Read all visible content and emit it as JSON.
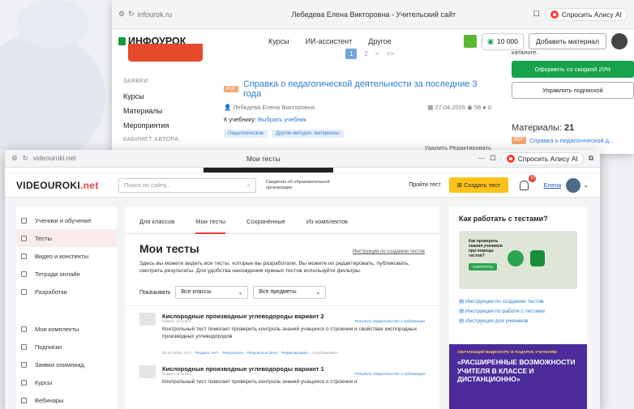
{
  "back": {
    "url": "infourok.ru",
    "tab_title": "Лебедева Елена Викторовна - Учительский сайт",
    "alice": "Спросить Алису AI",
    "logo": "ИНФОУРОК",
    "nav": [
      "Курсы",
      "ИИ-ассистент",
      "Другое"
    ],
    "balance": "10 000",
    "add_material": "Добавить материал",
    "sidebar": {
      "section": "ЗАЯВКИ",
      "items": [
        "Курсы",
        "Материалы",
        "Мероприятия"
      ],
      "section2": "КАБИНЕТ АВТОРА"
    },
    "pager": [
      "1",
      "2",
      ">",
      ">>"
    ],
    "article": {
      "badge": "PDF",
      "title": "Справка о педагогической деятельности за последние 3 года",
      "author": "Лебедева Елена Викторовна",
      "date": "27.04.2026",
      "views": "58",
      "comments": "0",
      "book_label": "К учебнику:",
      "book_link": "Выбрать учебник",
      "tags": [
        "Педагогическое",
        "Другие методич. материалы"
      ],
      "actions": "Удалить  Редактировать"
    },
    "right": {
      "catalog_text": "каталоге.",
      "discount_btn": "Оформить со скидкой 20%",
      "manage_btn": "Управлять подпиской",
      "materials_label": "Материалы:",
      "materials_count": "21",
      "material_link": "Справка о педагогической д..."
    }
  },
  "front": {
    "url": "videouroki.net",
    "tab_title": "Мои тесты",
    "alice": "Спросить Алису AI",
    "logo_a": "VIDEOUROKI",
    "logo_b": ".net",
    "search_placeholder": "Поиск по сайту...",
    "org_info": "Сведения об образовательной организации",
    "take_test": "Пройти тест",
    "create_test": "Создать тест",
    "notif_count": "10",
    "user": "Елена",
    "sidebar_top": [
      "Ученики и обучение",
      "Тесты",
      "Видео и конспекты",
      "Тетради онлайн",
      "Разработки"
    ],
    "sidebar_bottom": [
      "Мои комплекты",
      "Подписки",
      "Заявки олимпиад",
      "Курсы",
      "Вебинары"
    ],
    "tabs": [
      "Для классов",
      "Мои тесты",
      "Сохранённые",
      "Из комплектов"
    ],
    "page_title": "Мои тесты",
    "instruction_link": "Инструкция по созданию тестов",
    "description": "Здесь вы можете видеть все тесты, которые вы разработали. Вы можете их редактировать, публиковать, смотреть результаты. Для удобства нахождения нужных тестов используйте фильтры.",
    "show_label": "Показывать",
    "filter_class": "Все классы",
    "filter_subject": "Все предметы",
    "tests": [
      {
        "name": "Кислородные производные углеводороды вариант 2",
        "sub": "Химия, 10 класс",
        "cert": "Получить свидетельство о публикации",
        "desc": "Контрольный тест помогает проверить контроль знаний учащихся о строении и свойствах кислородных производных углеводородов",
        "meta": "28.04.2026,  12   0",
        "links": [
          "Раздать тест",
          "Результаты",
          "Результаты (все)",
          "Редактировать",
          "Опубликовать"
        ]
      },
      {
        "name": "Кислородные производные углеводороды вариант 1",
        "sub": "Химия, 10 класс",
        "cert": "Получить свидетельство о публикации",
        "desc": "Контрольный тест помогает проверить контроль знаний учащихся о строении и"
      }
    ],
    "howto": {
      "title": "Как работать с тестами?",
      "video_text": "Как проверить знания учеников при помощи тестов?",
      "video_btn": "СМОТРЕТЬ",
      "links": [
        "Инструкция по созданию тестов",
        "Инструкция по работе с тестами",
        "Инструкция для учеников"
      ]
    },
    "promo": {
      "small": "ОБУЧАЮЩИЙ ВИДЕОКУРС В ПОДАРОК УЧИТЕЛЯМ",
      "big": "«РАСШИРЕННЫЕ ВОЗМОЖНОСТИ УЧИТЕЛЯ В КЛАССЕ И ДИСТАНЦИОННО»"
    }
  }
}
